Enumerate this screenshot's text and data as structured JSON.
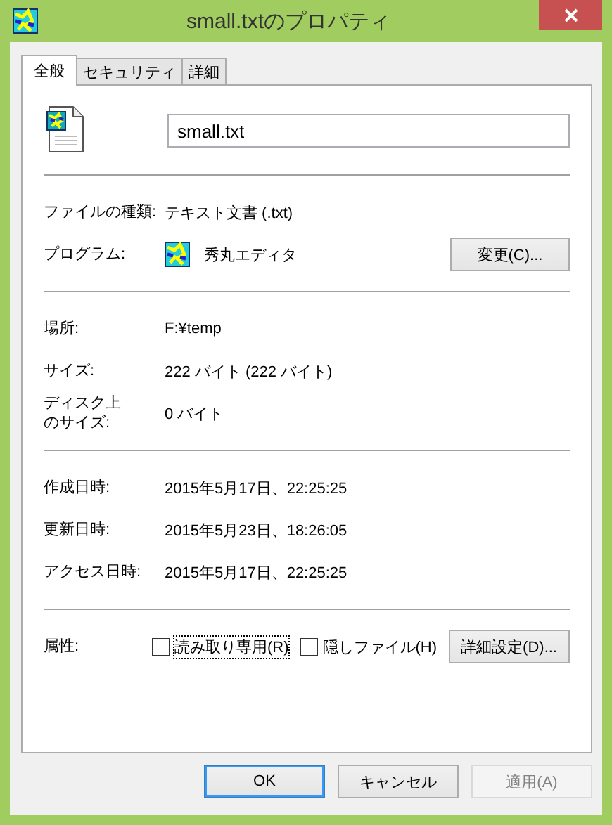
{
  "window": {
    "title": "small.txtのプロパティ"
  },
  "tabs": [
    {
      "label": "全般",
      "selected": true
    },
    {
      "label": "セキュリティ",
      "selected": false
    },
    {
      "label": "詳細",
      "selected": false
    }
  ],
  "file_name": {
    "value": "small.txt"
  },
  "sections": [
    [
      {
        "kind": "text",
        "label": "ファイルの種類:",
        "value": "テキスト文書 (.txt)"
      },
      {
        "kind": "program",
        "label": "プログラム:",
        "value": "秀丸エディタ",
        "button": "変更(C)..."
      }
    ],
    [
      {
        "kind": "text",
        "label": "場所:",
        "value": "F:¥temp"
      },
      {
        "kind": "text",
        "label": "サイズ:",
        "value": "222 バイト (222 バイト)"
      },
      {
        "kind": "text",
        "label_lines": [
          "ディスク上",
          "のサイズ:"
        ],
        "value": "0 バイト"
      }
    ],
    [
      {
        "kind": "text",
        "label": "作成日時:",
        "value": "2015年5月17日、22:25:25"
      },
      {
        "kind": "text",
        "label": "更新日時:",
        "value": "2015年5月23日、18:26:05"
      },
      {
        "kind": "text",
        "label": "アクセス日時:",
        "value": "2015年5月17日、22:25:25"
      }
    ]
  ],
  "attributes": {
    "label": "属性:",
    "checkboxes": [
      {
        "label": "読み取り専用(R)",
        "checked": false,
        "focused": true
      },
      {
        "label": "隠しファイル(H)",
        "checked": false,
        "focused": false
      }
    ],
    "button": "詳細設定(D)..."
  },
  "buttons": [
    {
      "label": "OK",
      "default": true,
      "disabled": false
    },
    {
      "label": "キャンセル",
      "default": false,
      "disabled": false
    },
    {
      "label": "適用(A)",
      "default": false,
      "disabled": true
    }
  ]
}
